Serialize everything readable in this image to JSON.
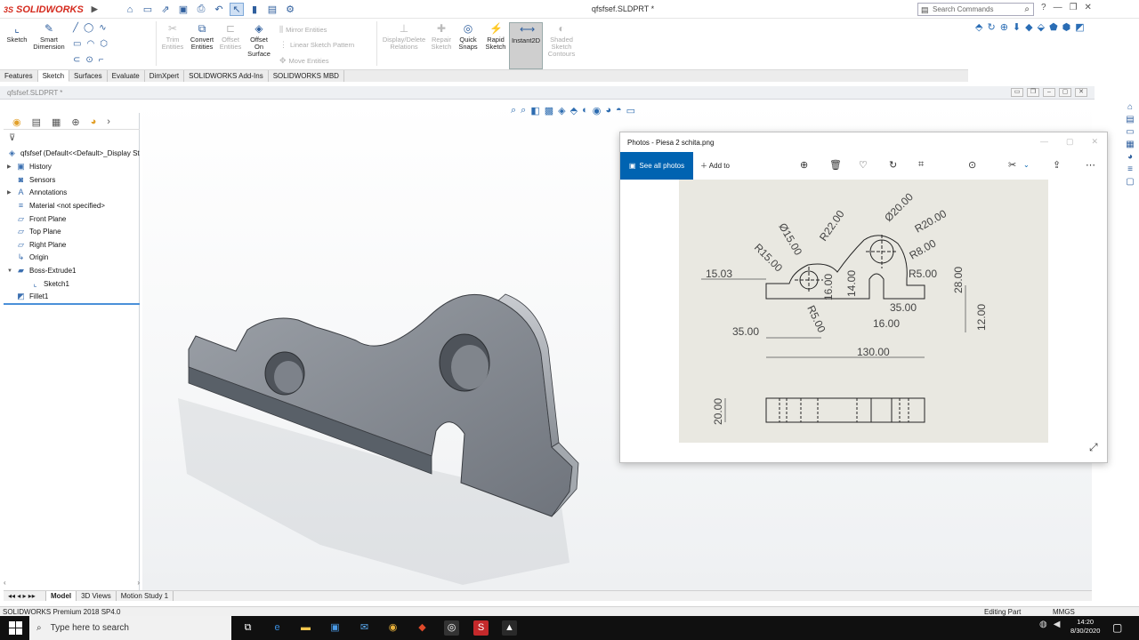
{
  "app": {
    "logo": "SOLIDWORKS",
    "document_title": "qfsfsef.SLDPRT *",
    "search_placeholder": "Search Commands"
  },
  "ribbon": {
    "sketch": "Sketch",
    "smart_dimension": "Smart Dimension",
    "trim": "Trim Entities",
    "convert": "Convert Entities",
    "offset": "Offset Entities",
    "offset_surface": "Offset On Surface",
    "mirror": "Mirror Entities",
    "linear_pattern": "Linear Sketch Pattern",
    "move": "Move Entities",
    "display_delete": "Display/Delete Relations",
    "repair": "Repair Sketch",
    "quick_snaps": "Quick Snaps",
    "rapid_sketch": "Rapid Sketch",
    "instant2d": "Instant2D",
    "shaded_contours": "Shaded Sketch Contours"
  },
  "tabs": [
    "Features",
    "Sketch",
    "Surfaces",
    "Evaluate",
    "DimXpert",
    "SOLIDWORKS Add-Ins",
    "SOLIDWORKS MBD"
  ],
  "doc_tab": "qfsfsef.SLDPRT *",
  "tree": {
    "root": "qfsfsef  (Default<<Default>_Display St",
    "items": [
      {
        "label": "History",
        "icon": "history-icon"
      },
      {
        "label": "Sensors",
        "icon": "sensor-icon"
      },
      {
        "label": "Annotations",
        "icon": "annotation-icon"
      },
      {
        "label": "Material <not specified>",
        "icon": "material-icon"
      },
      {
        "label": "Front Plane",
        "icon": "plane-icon"
      },
      {
        "label": "Top Plane",
        "icon": "plane-icon"
      },
      {
        "label": "Right Plane",
        "icon": "plane-icon"
      },
      {
        "label": "Origin",
        "icon": "origin-icon"
      },
      {
        "label": "Boss-Extrude1",
        "icon": "extrude-icon"
      },
      {
        "label": "Sketch1",
        "icon": "sketch-icon"
      },
      {
        "label": "Fillet1",
        "icon": "fillet-icon"
      }
    ]
  },
  "bottom_tabs": [
    "Model",
    "3D Views",
    "Motion Study 1"
  ],
  "status": {
    "product": "SOLIDWORKS Premium 2018 SP4.0",
    "mode": "Editing Part",
    "units": "MMGS"
  },
  "photos": {
    "title": "Photos - Piesa 2 schita.png",
    "see_all": "See all photos",
    "add_to": "Add to",
    "dimensions": [
      "R15.00",
      "R22.00",
      "Ø15.00",
      "Ø20.00",
      "R20.00",
      "R8.00",
      "R5.00",
      "15.03",
      "16.00",
      "14.00",
      "28.00",
      "R5.00",
      "35.00",
      "16.00",
      "12.00",
      "35.00",
      "130.00",
      "20.00"
    ]
  },
  "taskbar": {
    "search": "Type here to search",
    "time": "14:20",
    "date": "8/30/2020"
  },
  "colors": {
    "accent": "#0063b1",
    "brand": "#d52b1e",
    "part": "#7f848c"
  }
}
